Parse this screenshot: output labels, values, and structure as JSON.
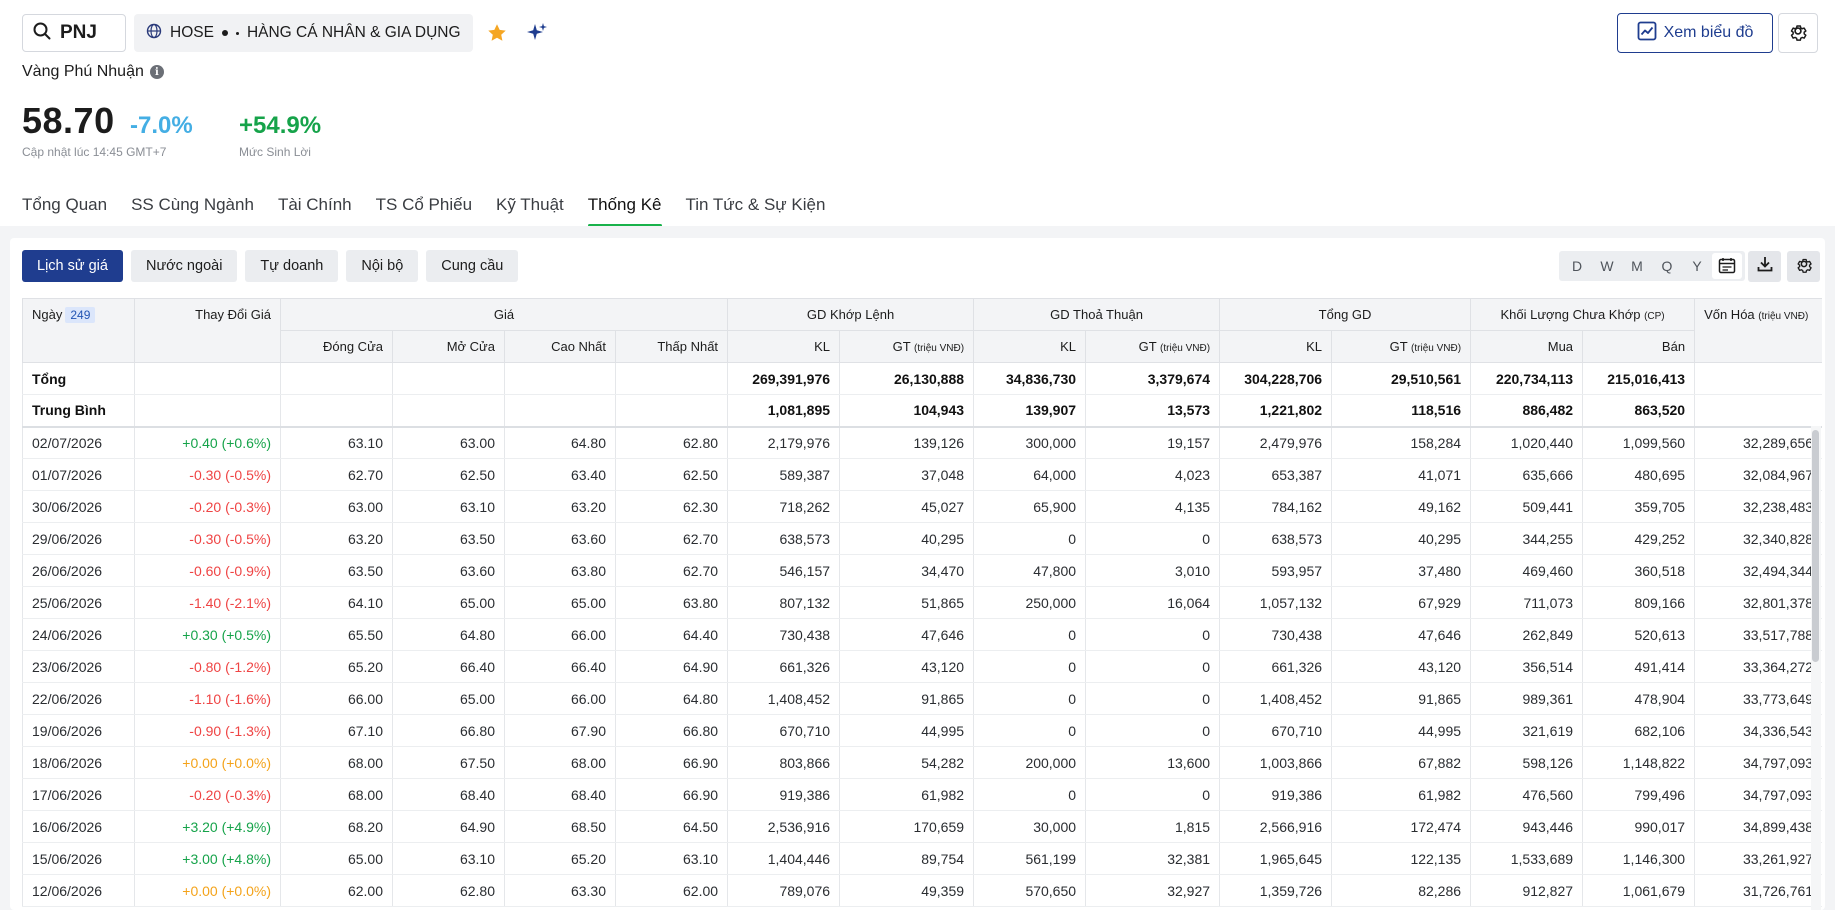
{
  "header": {
    "ticker": "PNJ",
    "exchange": "HOSE",
    "industry": "HÀNG CÁ NHÂN & GIA DỤNG",
    "chart_button": "Xem biểu đồ",
    "company_name": "Vàng Phú Nhuận",
    "info_icon": "i"
  },
  "quote": {
    "price": "58.70",
    "change_pct": "-7.0%",
    "updated": "Cập nhật lúc 14:45 GMT+7",
    "profit": "+54.9%",
    "profit_label": "Mức Sinh Lời"
  },
  "tabs": [
    "Tổng Quan",
    "SS Cùng Ngành",
    "Tài Chính",
    "TS Cổ Phiếu",
    "Kỹ Thuật",
    "Thống Kê",
    "Tin Tức & Sự Kiện"
  ],
  "active_tab": "Thống Kê",
  "subtabs": [
    "Lịch sử giá",
    "Nước ngoài",
    "Tự doanh",
    "Nội bộ",
    "Cung cầu"
  ],
  "periods": [
    "D",
    "W",
    "M",
    "Q",
    "Y"
  ],
  "table": {
    "group_headers": {
      "date": "Ngày",
      "count": "249",
      "change": "Thay Đổi Giá",
      "price": "Giá",
      "matched": "GD Khớp Lệnh",
      "negotiated": "GD Thoả Thuận",
      "total": "Tổng GD",
      "unmatched": "Khối Lượng Chưa Khớp",
      "unmatched_unit": "(CP)",
      "market_cap": "Vốn Hóa",
      "market_cap_unit": "(triệu VNĐ)"
    },
    "sub_headers": {
      "close": "Đóng Cửa",
      "open": "Mở Cửa",
      "high": "Cao Nhất",
      "low": "Thấp Nhất",
      "kl": "KL",
      "gt": "GT",
      "gt_unit": "(triệu VNĐ)",
      "buy": "Mua",
      "sell": "Bán"
    },
    "summary": [
      {
        "label": "Tổng",
        "m_kl": "269,391,976",
        "m_gt": "26,130,888",
        "n_kl": "34,836,730",
        "n_gt": "3,379,674",
        "t_kl": "304,228,706",
        "t_gt": "29,510,561",
        "buy": "220,734,113",
        "sell": "215,016,413"
      },
      {
        "label": "Trung Bình",
        "m_kl": "1,081,895",
        "m_gt": "104,943",
        "n_kl": "139,907",
        "n_gt": "13,573",
        "t_kl": "1,221,802",
        "t_gt": "118,516",
        "buy": "886,482",
        "sell": "863,520"
      }
    ],
    "rows": [
      {
        "date": "02/07/2026",
        "chg": "+0.40 (+0.6%)",
        "dir": "up",
        "close": "63.10",
        "open": "63.00",
        "high": "64.80",
        "low": "62.80",
        "m_kl": "2,179,976",
        "m_gt": "139,126",
        "n_kl": "300,000",
        "n_gt": "19,157",
        "t_kl": "2,479,976",
        "t_gt": "158,284",
        "buy": "1,020,440",
        "sell": "1,099,560",
        "cap": "32,289,656"
      },
      {
        "date": "01/07/2026",
        "chg": "-0.30 (-0.5%)",
        "dir": "down",
        "close": "62.70",
        "open": "62.50",
        "high": "63.40",
        "low": "62.50",
        "m_kl": "589,387",
        "m_gt": "37,048",
        "n_kl": "64,000",
        "n_gt": "4,023",
        "t_kl": "653,387",
        "t_gt": "41,071",
        "buy": "635,666",
        "sell": "480,695",
        "cap": "32,084,967"
      },
      {
        "date": "30/06/2026",
        "chg": "-0.20 (-0.3%)",
        "dir": "down",
        "close": "63.00",
        "open": "63.10",
        "high": "63.20",
        "low": "62.30",
        "m_kl": "718,262",
        "m_gt": "45,027",
        "n_kl": "65,900",
        "n_gt": "4,135",
        "t_kl": "784,162",
        "t_gt": "49,162",
        "buy": "509,441",
        "sell": "359,705",
        "cap": "32,238,483"
      },
      {
        "date": "29/06/2026",
        "chg": "-0.30 (-0.5%)",
        "dir": "down",
        "close": "63.20",
        "open": "63.50",
        "high": "63.60",
        "low": "62.70",
        "m_kl": "638,573",
        "m_gt": "40,295",
        "n_kl": "0",
        "n_gt": "0",
        "t_kl": "638,573",
        "t_gt": "40,295",
        "buy": "344,255",
        "sell": "429,252",
        "cap": "32,340,828"
      },
      {
        "date": "26/06/2026",
        "chg": "-0.60 (-0.9%)",
        "dir": "down",
        "close": "63.50",
        "open": "63.60",
        "high": "63.80",
        "low": "62.70",
        "m_kl": "546,157",
        "m_gt": "34,470",
        "n_kl": "47,800",
        "n_gt": "3,010",
        "t_kl": "593,957",
        "t_gt": "37,480",
        "buy": "469,460",
        "sell": "360,518",
        "cap": "32,494,344"
      },
      {
        "date": "25/06/2026",
        "chg": "-1.40 (-2.1%)",
        "dir": "down",
        "close": "64.10",
        "open": "65.00",
        "high": "65.00",
        "low": "63.80",
        "m_kl": "807,132",
        "m_gt": "51,865",
        "n_kl": "250,000",
        "n_gt": "16,064",
        "t_kl": "1,057,132",
        "t_gt": "67,929",
        "buy": "711,073",
        "sell": "809,166",
        "cap": "32,801,378"
      },
      {
        "date": "24/06/2026",
        "chg": "+0.30 (+0.5%)",
        "dir": "up",
        "close": "65.50",
        "open": "64.80",
        "high": "66.00",
        "low": "64.40",
        "m_kl": "730,438",
        "m_gt": "47,646",
        "n_kl": "0",
        "n_gt": "0",
        "t_kl": "730,438",
        "t_gt": "47,646",
        "buy": "262,849",
        "sell": "520,613",
        "cap": "33,517,788"
      },
      {
        "date": "23/06/2026",
        "chg": "-0.80 (-1.2%)",
        "dir": "down",
        "close": "65.20",
        "open": "66.40",
        "high": "66.40",
        "low": "64.90",
        "m_kl": "661,326",
        "m_gt": "43,120",
        "n_kl": "0",
        "n_gt": "0",
        "t_kl": "661,326",
        "t_gt": "43,120",
        "buy": "356,514",
        "sell": "491,414",
        "cap": "33,364,272"
      },
      {
        "date": "22/06/2026",
        "chg": "-1.10 (-1.6%)",
        "dir": "down",
        "close": "66.00",
        "open": "65.00",
        "high": "66.00",
        "low": "64.80",
        "m_kl": "1,408,452",
        "m_gt": "91,865",
        "n_kl": "0",
        "n_gt": "0",
        "t_kl": "1,408,452",
        "t_gt": "91,865",
        "buy": "989,361",
        "sell": "478,904",
        "cap": "33,773,649"
      },
      {
        "date": "19/06/2026",
        "chg": "-0.90 (-1.3%)",
        "dir": "down",
        "close": "67.10",
        "open": "66.80",
        "high": "67.90",
        "low": "66.80",
        "m_kl": "670,710",
        "m_gt": "44,995",
        "n_kl": "0",
        "n_gt": "0",
        "t_kl": "670,710",
        "t_gt": "44,995",
        "buy": "321,619",
        "sell": "682,106",
        "cap": "34,336,543"
      },
      {
        "date": "18/06/2026",
        "chg": "+0.00 (+0.0%)",
        "dir": "flat",
        "close": "68.00",
        "open": "67.50",
        "high": "68.00",
        "low": "66.90",
        "m_kl": "803,866",
        "m_gt": "54,282",
        "n_kl": "200,000",
        "n_gt": "13,600",
        "t_kl": "1,003,866",
        "t_gt": "67,882",
        "buy": "598,126",
        "sell": "1,148,822",
        "cap": "34,797,093"
      },
      {
        "date": "17/06/2026",
        "chg": "-0.20 (-0.3%)",
        "dir": "down",
        "close": "68.00",
        "open": "68.40",
        "high": "68.40",
        "low": "66.90",
        "m_kl": "919,386",
        "m_gt": "61,982",
        "n_kl": "0",
        "n_gt": "0",
        "t_kl": "919,386",
        "t_gt": "61,982",
        "buy": "476,560",
        "sell": "799,496",
        "cap": "34,797,093"
      },
      {
        "date": "16/06/2026",
        "chg": "+3.20 (+4.9%)",
        "dir": "up",
        "close": "68.20",
        "open": "64.90",
        "high": "68.50",
        "low": "64.50",
        "m_kl": "2,536,916",
        "m_gt": "170,659",
        "n_kl": "30,000",
        "n_gt": "1,815",
        "t_kl": "2,566,916",
        "t_gt": "172,474",
        "buy": "943,446",
        "sell": "990,017",
        "cap": "34,899,438"
      },
      {
        "date": "15/06/2026",
        "chg": "+3.00 (+4.8%)",
        "dir": "up",
        "close": "65.00",
        "open": "63.10",
        "high": "65.20",
        "low": "63.10",
        "m_kl": "1,404,446",
        "m_gt": "89,754",
        "n_kl": "561,199",
        "n_gt": "32,381",
        "t_kl": "1,965,645",
        "t_gt": "122,135",
        "buy": "1,533,689",
        "sell": "1,146,300",
        "cap": "33,261,927"
      },
      {
        "date": "12/06/2026",
        "chg": "+0.00 (+0.0%)",
        "dir": "flat",
        "close": "62.00",
        "open": "62.80",
        "high": "63.30",
        "low": "62.00",
        "m_kl": "789,076",
        "m_gt": "49,359",
        "n_kl": "570,650",
        "n_gt": "32,927",
        "t_kl": "1,359,726",
        "t_gt": "82,286",
        "buy": "912,827",
        "sell": "1,061,679",
        "cap": "31,726,761"
      }
    ]
  },
  "colors": {
    "accent": "#1f3d8f",
    "up": "#16a34a",
    "down": "#ef4444",
    "flat": "#f4a31a",
    "change_pct": "#44aee4",
    "tab_indicator": "#19b24b"
  }
}
